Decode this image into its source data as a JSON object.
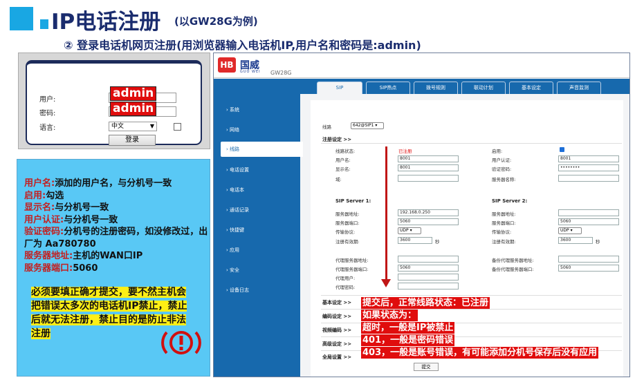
{
  "title": {
    "main": "IP电话注册",
    "sub": "(以GW28G为例)"
  },
  "subtitle": "② 登录电话机网页注册(用浏览器输入电话机IP,用户名和密码是:admin)",
  "login": {
    "user_label": "用户:",
    "pass_label": "密码:",
    "lang_label": "语言:",
    "user_value": "admin",
    "pass_value": "admin",
    "lang_value": "中文",
    "button": "登录"
  },
  "info": {
    "lines": [
      {
        "k": "用户名:",
        "v": "添加的用户名，与分机号一致"
      },
      {
        "k": "启用:",
        "v": "勾选"
      },
      {
        "k": "显示名:",
        "v": "与分机号一致"
      },
      {
        "k": "用户认证:",
        "v": "与分机号一致"
      },
      {
        "k": "验证密码:",
        "v": "分机号的注册密码，如没修改过，出厂为 Aa780780"
      },
      {
        "k": "服务器地址:",
        "v": "主机的WAN口IP"
      },
      {
        "k": "服务器端口:",
        "v": "5060"
      }
    ],
    "warning": "必须要填正确才提交，要不然主机会把错误太多次的电话机IP禁止，禁止后就无法注册，禁止目的是防止非法注册"
  },
  "web": {
    "logo_mark": "HB",
    "brand": "国威",
    "brand_small": "GUO WEI",
    "model": "GW28G",
    "sidebar": [
      "系统",
      "网络",
      "线路",
      "电话设置",
      "电话本",
      "通话记录",
      "快捷键",
      "应用",
      "安全",
      "设备日志"
    ],
    "tabs": [
      "SIP",
      "SIP热点",
      "拨号规则",
      "联动计划",
      "基本设定",
      "声音监测"
    ],
    "line_label": "线路",
    "line_value": "642@SIP1",
    "reg_section": "注册设定 >>",
    "fields": {
      "line_status_label": "线路状态:",
      "line_status_value": "已注册",
      "enable_label": "启用:",
      "username_label": "用户名:",
      "username_value": "8001",
      "auth_user_label": "用户认证:",
      "auth_user_value": "8001",
      "display_label": "显示名:",
      "display_value": "8001",
      "auth_pass_label": "验证密码:",
      "auth_pass_value": "••••••••",
      "domain_label": "域:",
      "server_name_label": "服务器名称:"
    },
    "server1": {
      "title": "SIP Server 1:",
      "addr_label": "服务器地址:",
      "addr_value": "192.168.0.250",
      "port_label": "服务器端口:",
      "port_value": "5060",
      "proto_label": "传输协议:",
      "proto_value": "UDP",
      "expire_label": "注册有效期:",
      "expire_value": "3600",
      "unit": "秒"
    },
    "server2": {
      "title": "SIP Server 2:",
      "addr_label": "服务器地址:",
      "addr_value": "",
      "port_label": "服务器端口:",
      "port_value": "5060",
      "proto_label": "传输协议:",
      "proto_value": "UDP",
      "expire_label": "注册有效期:",
      "expire_value": "3600",
      "unit": "秒"
    },
    "proxy": {
      "addr_label": "代理服务器地址:",
      "port_label": "代理服务器端口:",
      "port_value": "5060",
      "user_label": "代理用户:",
      "pass_label": "代理密码:",
      "backup_addr_label": "备份代理服务器地址:",
      "backup_port_label": "备份代理服务器端口:",
      "backup_port_value": "5060"
    },
    "sections": [
      "基本设定 >>",
      "编码设定 >>",
      "视频编码 >>",
      "高级设定 >>",
      "全局设置 >>"
    ],
    "submit": "提交"
  },
  "annotations": [
    "提交后，正常线路状态：已注册",
    "如果状态为：",
    "超时，一般是IP被禁止",
    "401，一般是密码错误",
    "403，一般是账号错误，有可能添加分机号保存后没有应用"
  ]
}
